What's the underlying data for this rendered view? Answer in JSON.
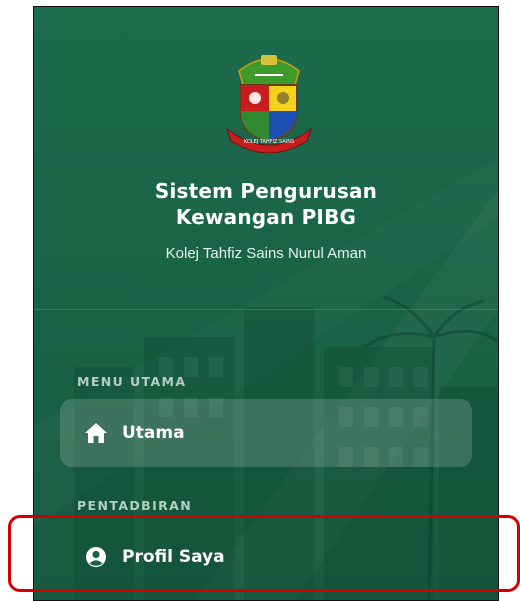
{
  "app": {
    "title_line1": "Sistem Pengurusan",
    "title_line2": "Kewangan PIBG",
    "subtitle": "Kolej Tahfiz Sains Nurul Aman",
    "logo_icon": "school-crest-icon",
    "logo_text": "KOLEJ TAHFIZ SAINS"
  },
  "sections": {
    "main_label": "MENU UTAMA",
    "admin_label": "PENTADBIRAN"
  },
  "nav": {
    "home": {
      "label": "Utama",
      "icon": "home-icon",
      "active": true
    },
    "profile": {
      "label": "Profil Saya",
      "icon": "user-circle-icon",
      "active": false
    }
  },
  "colors": {
    "sidebar_bg": "#1a6347",
    "text": "#ffffff",
    "active_bg": "rgba(255,255,255,0.16)",
    "highlight": "#d40000"
  }
}
